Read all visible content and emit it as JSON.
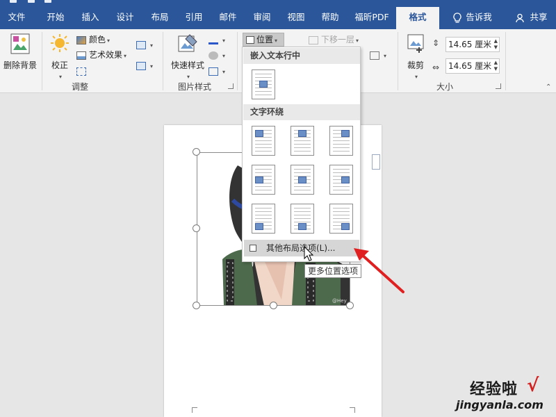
{
  "tabs": [
    "文件",
    "开始",
    "插入",
    "设计",
    "布局",
    "引用",
    "邮件",
    "审阅",
    "视图",
    "帮助",
    "福昕PDF",
    "格式"
  ],
  "tell_me": "告诉我",
  "share": "共享",
  "ribbon": {
    "remove_bg": "删除背景",
    "correct": "校正",
    "color": "颜色",
    "art_effects": "艺术效果",
    "adjust_group": "调整",
    "quick_styles": "快速样式",
    "pic_styles_group": "图片样式",
    "position": "位置",
    "send_backward": "下移一层",
    "crop": "裁剪",
    "height": "14.65 厘米",
    "width": "14.65 厘米",
    "size_group": "大小"
  },
  "menu": {
    "inline_header": "嵌入文本行中",
    "wrap_header": "文字环绕",
    "more_options": "其他布局选项(L)...",
    "tooltip": "更多位置选项"
  },
  "watermark": {
    "line1": "经验啦",
    "line2": "jingyanla.com",
    "mark": "√"
  },
  "colors": {
    "title_bar": "#2b579a",
    "ribbon_bg": "#f3f3f3",
    "doc_bg": "#e6e6e6",
    "arrow": "#e02020",
    "jacket": "#4e6a4c"
  }
}
